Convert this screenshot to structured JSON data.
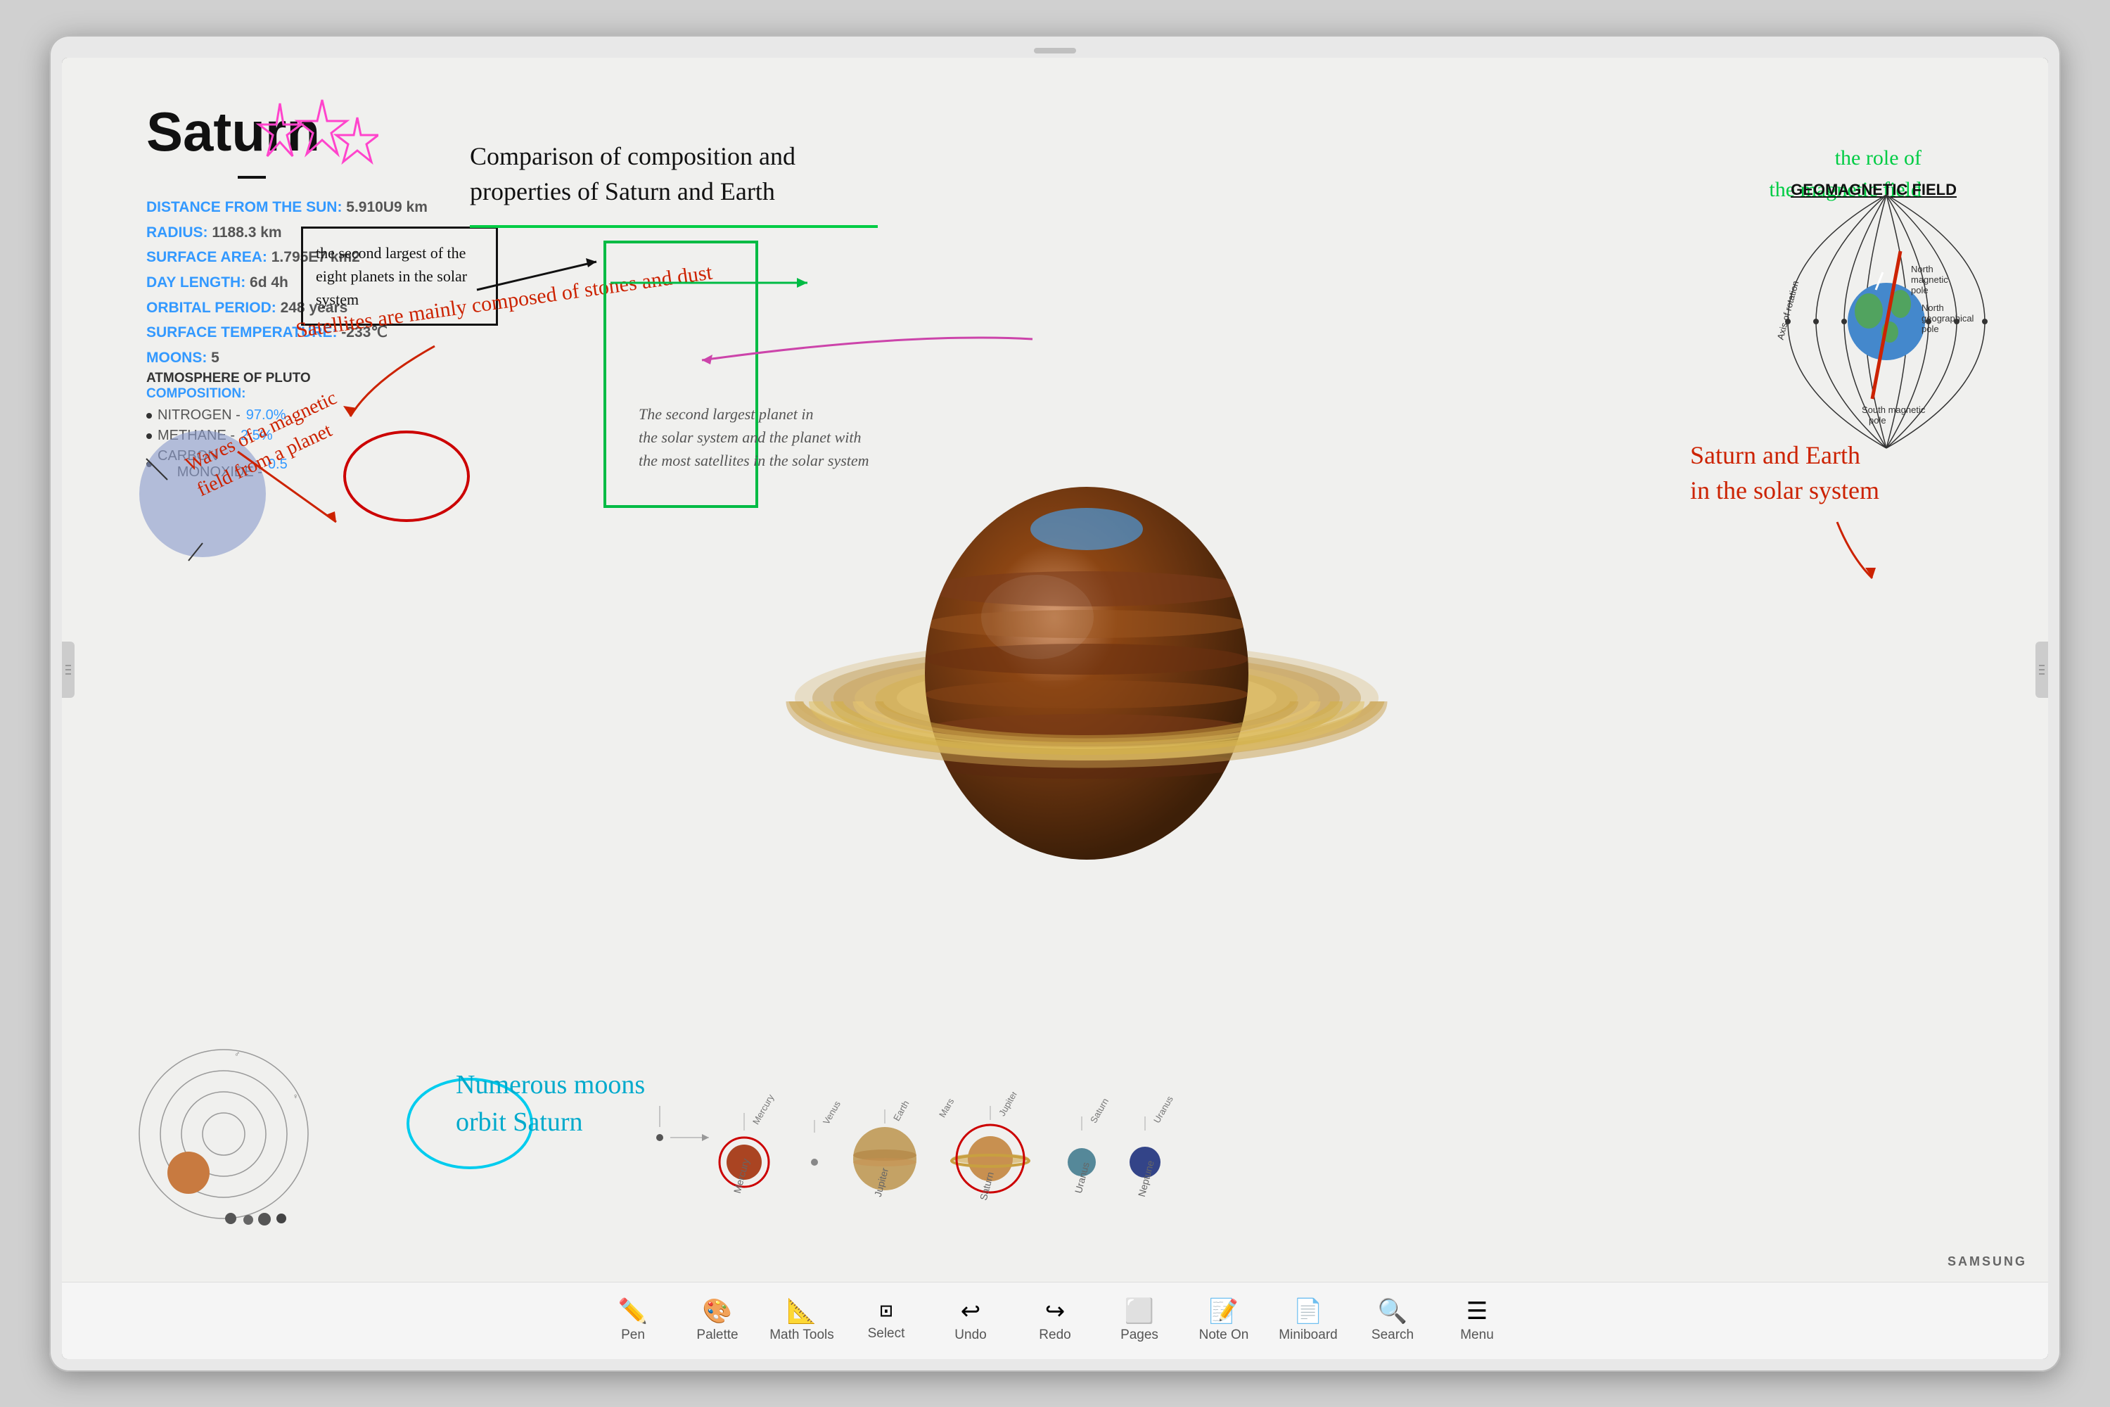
{
  "monitor": {
    "brand": "SAMSUNG"
  },
  "content": {
    "saturn_title": "Saturn",
    "comparison_heading": "Comparison of composition and\nproperties of Saturn and Earth",
    "magnetic_role": "the role of\nthe magnetic field",
    "info": {
      "distance_label": "DISTANCE FROM THE SUN:",
      "distance_value": "5.910U9 km",
      "radius_label": "RADIUS:",
      "radius_value": "1188.3 km",
      "surface_area_label": "SURFACE AREA:",
      "surface_area_value": "1.795E7 km2",
      "day_length_label": "DAY LENGTH:",
      "day_length_value": "6d  4h",
      "orbital_period_label": "ORBITAL PERIOD:",
      "orbital_period_value": "248 years",
      "surface_temp_label": "SURFACE TEMPERATURE:",
      "surface_temp_value": "-233℃",
      "moons_label": "MOONS:",
      "moons_value": "5"
    },
    "atmosphere": {
      "title": "ATMOSPHERE OF PLUTO",
      "subtitle": "COMPOSITION:",
      "items": [
        {
          "label": "NITROGEN",
          "pct": "97.0%"
        },
        {
          "label": "METHANE",
          "pct": "2.5%"
        },
        {
          "label": "CARBON MONOXIDE",
          "pct": "0.5"
        }
      ]
    },
    "handwritten": {
      "black_box": "the second largest of\nthe eight planets in\nthe solar system",
      "satellites": "Satellites are mainly\ncomposed of stones and dust",
      "waves": "Waves of a magnetic\nfield from a planet",
      "moons": "Numerous moons\norbit Saturn",
      "second_largest": "The second largest planet in\nthe solar system and the planet with\nthe most satellites in the solar system",
      "saturn_earth": "Saturn and Earth\nin the solar system"
    },
    "geo": {
      "title": "GEOMAGNETIC FIELD",
      "north_mag": "North magnetic pole",
      "north_geo": "North geographical pole",
      "south_mag": "South magnetic pole",
      "axis": "Axis of rotation"
    }
  },
  "toolbar": {
    "items": [
      {
        "id": "pen",
        "label": "Pen",
        "icon": "✏️"
      },
      {
        "id": "palette",
        "label": "Palette",
        "icon": "🎨"
      },
      {
        "id": "math-tools",
        "label": "Math Tools",
        "icon": "📐"
      },
      {
        "id": "select",
        "label": "Select",
        "icon": "⊞"
      },
      {
        "id": "undo",
        "label": "Undo",
        "icon": "↩"
      },
      {
        "id": "redo",
        "label": "Redo",
        "icon": "↪"
      },
      {
        "id": "pages",
        "label": "Pages",
        "icon": "⬜"
      },
      {
        "id": "note-on",
        "label": "Note On",
        "icon": "📝"
      },
      {
        "id": "miniboard",
        "label": "Miniboard",
        "icon": "📄"
      },
      {
        "id": "search",
        "label": "Search",
        "icon": "🔍"
      },
      {
        "id": "menu",
        "label": "Menu",
        "icon": "☰"
      }
    ]
  }
}
